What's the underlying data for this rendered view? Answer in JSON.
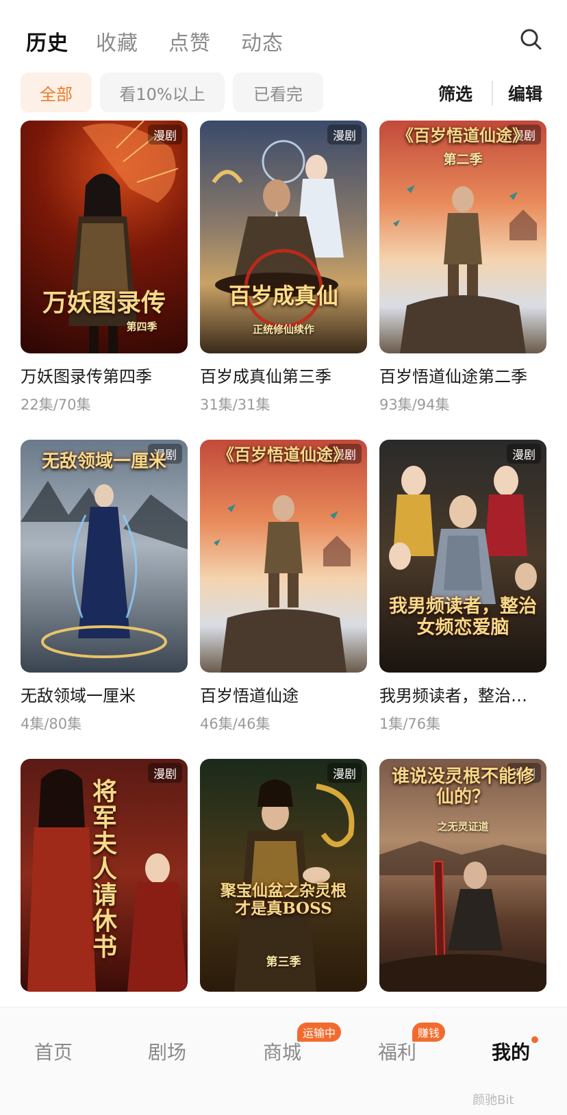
{
  "tabs": [
    "历史",
    "收藏",
    "点赞",
    "动态"
  ],
  "filters": [
    "全部",
    "看10%以上",
    "已看完"
  ],
  "actions": {
    "filter": "筛选",
    "edit": "编辑"
  },
  "badge_label": "漫剧",
  "colors": {
    "accent": "#f07a2a",
    "chip_bg": "#f5f5f5",
    "chip_active_bg": "#fdf0e6"
  },
  "items": [
    {
      "name": "万妖图录传第四季",
      "progress": "22集/70集",
      "cover_title": "万妖图录传",
      "cover_sub": "第四季"
    },
    {
      "name": "百岁成真仙第三季",
      "progress": "31集/31集",
      "cover_title": "百岁成真仙",
      "cover_sub": "正统修仙续作"
    },
    {
      "name": "百岁悟道仙途第二季",
      "progress": "93集/94集",
      "cover_title": "《百岁悟道仙途》",
      "cover_sub": "第二季"
    },
    {
      "name": "无敌领域一厘米",
      "progress": "4集/80集",
      "cover_title": "无敌领域一厘米",
      "cover_sub": ""
    },
    {
      "name": "百岁悟道仙途",
      "progress": "46集/46集",
      "cover_title": "《百岁悟道仙途》",
      "cover_sub": ""
    },
    {
      "name": "我男频读者，整治…",
      "progress": "1集/76集",
      "cover_title": "我男频读者，整治女频恋爱脑",
      "cover_sub": ""
    },
    {
      "name": "",
      "progress": "",
      "cover_title": "将军夫人请休书",
      "cover_sub": ""
    },
    {
      "name": "",
      "progress": "",
      "cover_title": "聚宝仙盆之杂灵根才是真BOSS",
      "cover_sub": "第三季"
    },
    {
      "name": "",
      "progress": "",
      "cover_title": "谁说没灵根不能修仙的？",
      "cover_sub": "之无灵证道"
    }
  ],
  "nav": [
    {
      "label": "首页",
      "badge": ""
    },
    {
      "label": "剧场",
      "badge": ""
    },
    {
      "label": "商城",
      "badge": "运输中"
    },
    {
      "label": "福利",
      "badge": "赚钱"
    },
    {
      "label": "我的",
      "badge": ""
    }
  ],
  "watermark": "颜驰Bit"
}
